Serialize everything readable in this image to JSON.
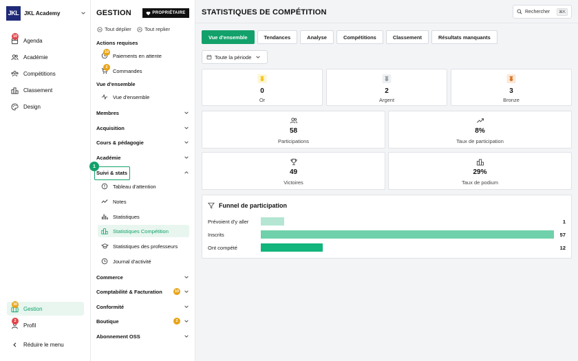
{
  "brand": {
    "logo": "JKL",
    "name": "JKL Academy"
  },
  "nav": {
    "items": [
      {
        "label": "Agenda",
        "icon": "calendar-icon",
        "badge": "10"
      },
      {
        "label": "Académie",
        "icon": "users-icon"
      },
      {
        "label": "Compétitions",
        "icon": "users-group-icon"
      },
      {
        "label": "Classement",
        "icon": "podium-icon"
      },
      {
        "label": "Design",
        "icon": "palette-icon"
      }
    ],
    "bottom": [
      {
        "label": "Gestion",
        "icon": "briefcase-icon",
        "badge": "30",
        "active": true
      },
      {
        "label": "Profil",
        "icon": "user-icon",
        "badge": "2"
      }
    ],
    "collapse_label": "Réduire le menu"
  },
  "section": {
    "title": "GESTION",
    "owner_badge": "PROPRIÉTAIRE",
    "expand_all": "Tout déplier",
    "collapse_all": "Tout replier",
    "required_title": "Actions requises",
    "required_items": [
      {
        "label": "Paiements en attente",
        "badge": "10"
      },
      {
        "label": "Commandes",
        "badge": "2"
      }
    ],
    "overview_title": "Vue d'ensemble",
    "overview_item": "Vue d'ensemble",
    "groups_top": [
      "Membres",
      "Acquisition",
      "Cours & pédagogie",
      "Académie"
    ],
    "open_group": "Suivi & stats",
    "open_items": [
      "Tableau d'attention",
      "Notes",
      "Statistiques",
      "Statistiques Compétition",
      "Statistiques des professeurs",
      "Journal d'activité"
    ],
    "groups_bottom": [
      {
        "label": "Commerce"
      },
      {
        "label": "Comptabilité & Facturation",
        "badge": "10"
      },
      {
        "label": "Conformité"
      },
      {
        "label": "Boutique",
        "badge": "2"
      },
      {
        "label": "Abonnement OSS"
      }
    ],
    "step_marker": "1"
  },
  "main": {
    "title": "STATISTIQUES DE COMPÉTITION",
    "search_label": "Rechercher",
    "search_shortcut": "⌘K",
    "tabs": [
      "Vue d'ensemble",
      "Tendances",
      "Analyse",
      "Compétitions",
      "Classement",
      "Résultats manquants"
    ],
    "period": "Toute la période",
    "medals": [
      {
        "value": "0",
        "label": "Or",
        "color": "#f5c518",
        "bg": "#fdf6d3"
      },
      {
        "value": "2",
        "label": "Argent",
        "color": "#9aa1a8",
        "bg": "#eef0f2"
      },
      {
        "value": "3",
        "label": "Bronze",
        "color": "#d9792b",
        "bg": "#fbe8d8"
      }
    ],
    "stats": [
      {
        "value": "58",
        "label": "Participations",
        "icon": "users-icon"
      },
      {
        "value": "8%",
        "label": "Taux de participation",
        "icon": "trend-up-icon"
      },
      {
        "value": "49",
        "label": "Victoires",
        "icon": "trophy-icon"
      },
      {
        "value": "29%",
        "label": "Taux de podium",
        "icon": "podium-icon"
      }
    ],
    "funnel": {
      "title": "Funnel de participation",
      "max": 57,
      "rows": [
        {
          "label": "Prévoient d'y aller",
          "value": 1,
          "display": "1",
          "color": "#b5e6d3"
        },
        {
          "label": "Inscrits",
          "value": 57,
          "display": "57",
          "color": "#6fd1ab"
        },
        {
          "label": "Ont compété",
          "value": 12,
          "display": "12",
          "color": "#12b57b"
        }
      ]
    }
  }
}
